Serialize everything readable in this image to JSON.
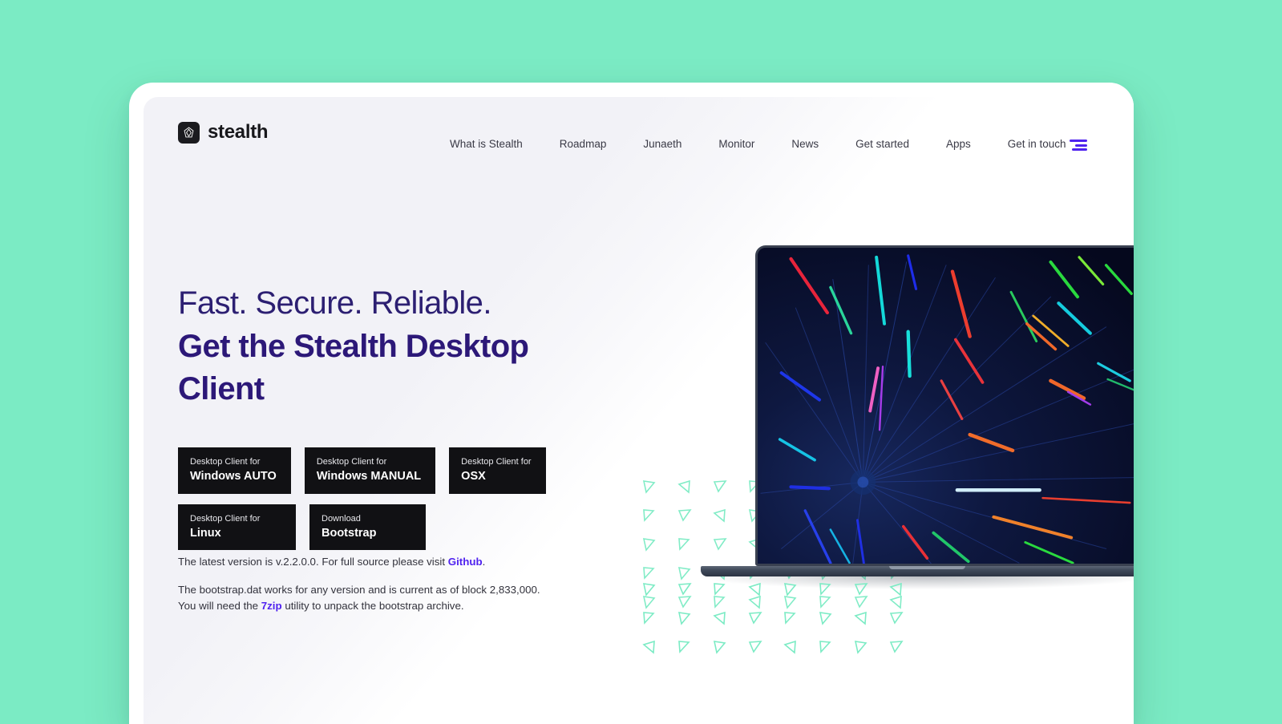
{
  "theme": {
    "page_background": "#7bebc4",
    "accent_purple": "#4f22ef",
    "heading_navy": "#2c1878",
    "button_black": "#111114",
    "pattern_teal": "#7bebc4"
  },
  "brand": {
    "name": "stealth",
    "mark_icon": "stealth-diamond-logo-icon"
  },
  "nav": {
    "links": [
      {
        "label": "What is Stealth"
      },
      {
        "label": "Roadmap"
      },
      {
        "label": "Junaeth"
      },
      {
        "label": "Monitor"
      },
      {
        "label": "News"
      },
      {
        "label": "Get started"
      },
      {
        "label": "Apps"
      },
      {
        "label": "Get in touch"
      }
    ],
    "menu_toggle_icon": "hamburger-menu-icon"
  },
  "hero": {
    "eyebrow": "Fast. Secure. Reliable.",
    "title_line_1": "Get the Stealth Desktop",
    "title_line_2": "Client"
  },
  "downloads": {
    "row1": [
      {
        "sub": "Desktop Client for",
        "main": "Windows AUTO"
      },
      {
        "sub": "Desktop Client for",
        "main": "Windows MANUAL"
      },
      {
        "sub": "Desktop Client for",
        "main": "OSX"
      }
    ],
    "row2": [
      {
        "sub": "Desktop Client for",
        "main": "Linux"
      },
      {
        "sub": "Download",
        "main": "Bootstrap"
      }
    ]
  },
  "notes": {
    "note1": {
      "prefix": "The latest version is v.2.2.0.0. For full source please visit ",
      "link": "Github",
      "suffix": "."
    },
    "note2": {
      "prefix": "The bootstrap.dat works for any version and is current as of block 2,833,000. You will need the ",
      "link": "7zip",
      "suffix": " utility to unpack the bootstrap archive."
    }
  },
  "visual": {
    "laptop_label": "laptop-mockup",
    "wallpaper_label": "radial-light-streaks-wallpaper",
    "pattern_label": "teal-triangle-pattern"
  }
}
